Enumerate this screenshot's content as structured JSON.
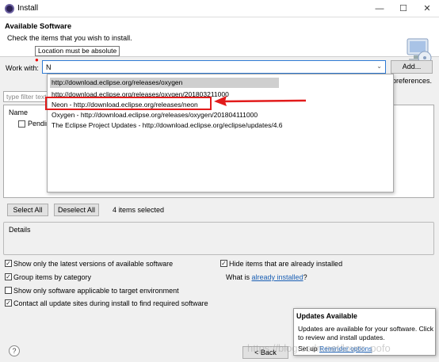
{
  "window": {
    "title": "Install",
    "minimize": "—",
    "maximize": "☐",
    "close": "✕"
  },
  "header": {
    "title": "Available Software",
    "subtitle": "Check the items that you wish to install."
  },
  "tooltip": "Location must be absolute",
  "work_with": {
    "label": "Work with:",
    "value": "N",
    "add_label": "Add...",
    "preferences_fragment": "preferences."
  },
  "filter": {
    "placeholder": "type filter text"
  },
  "tree": {
    "column_header": "Name",
    "item": "Pendin"
  },
  "dropdown": {
    "items": [
      "http://download.eclipse.org/releases/oxygen",
      "http://download.eclipse.org/releases/oxygen/201803211000",
      "Neon - http://download.eclipse.org/releases/neon",
      "Oxygen - http://download.eclipse.org/releases/oxygen/201804111000",
      "The Eclipse Project Updates - http://download.eclipse.org/eclipse/updates/4.6"
    ],
    "selected_index": 0,
    "highlighted_index": 2
  },
  "selection": {
    "select_all": "Select All",
    "deselect_all": "Deselect All",
    "count": "4 items selected"
  },
  "details": {
    "label": "Details"
  },
  "options": {
    "latest_versions": {
      "label": "Show only the latest versions of available software",
      "checked": true
    },
    "hide_installed": {
      "label": "Hide items that are already installed",
      "checked": true
    },
    "group_by_category": {
      "label": "Group items by category",
      "checked": true
    },
    "target_env": {
      "label": "Show only software applicable to target environment",
      "checked": false
    },
    "contact_sites": {
      "label": "Contact all update sites during install to find required software",
      "checked": true
    },
    "what_is": "What is",
    "already_installed_link": "already installed",
    "question_mark": "?"
  },
  "footer": {
    "help": "?",
    "back_label": "< Back"
  },
  "popup": {
    "title": "Updates Available",
    "body": "Updates are available for your software. Click to review and install updates.",
    "setup_prefix": "Set up",
    "setup_link": "Reminder options"
  },
  "watermark": "https://blog.csdn.net/lover_pofo",
  "colors": {
    "highlight": "#e21b1b",
    "link": "#1a5fb4",
    "focus": "#2f7bd4"
  }
}
